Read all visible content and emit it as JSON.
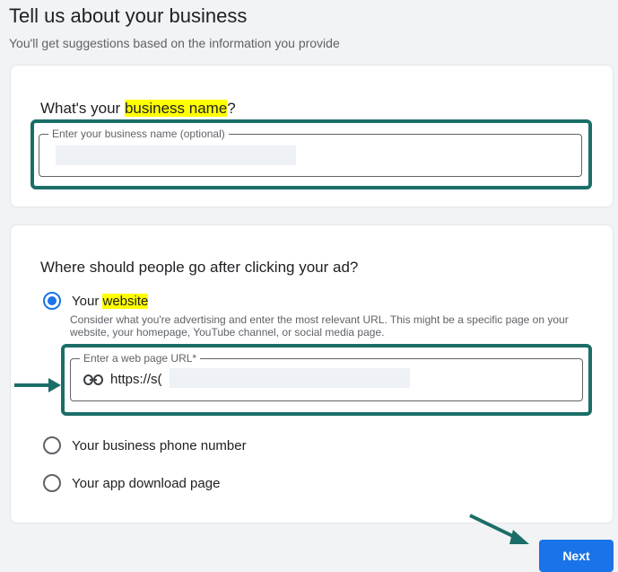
{
  "header": {
    "title": "Tell us about your business",
    "subtitle": "You'll get suggestions based on the information you provide"
  },
  "business_name_card": {
    "question_prefix": "What's your ",
    "question_highlight": "business name",
    "question_suffix": "?",
    "field_label": "Enter your business name (optional)",
    "field_value": ""
  },
  "destination_card": {
    "question": "Where should people go after clicking your ad?",
    "options": [
      {
        "label_prefix": "Your ",
        "label_highlight": "website",
        "selected": true,
        "hint": "Consider what you're advertising and enter the most relevant URL. This might be a specific page on your website, your homepage, YouTube channel, or social media page."
      },
      {
        "label": "Your business phone number",
        "selected": false
      },
      {
        "label": "Your app download page",
        "selected": false
      }
    ],
    "url_field": {
      "label": "Enter a web page URL*",
      "icon": "link-icon",
      "value": "https://s("
    }
  },
  "footer": {
    "next_label": "Next"
  },
  "colors": {
    "accent": "#1a73e8",
    "highlight": "#ffff00",
    "annotation": "#1b6e67"
  }
}
